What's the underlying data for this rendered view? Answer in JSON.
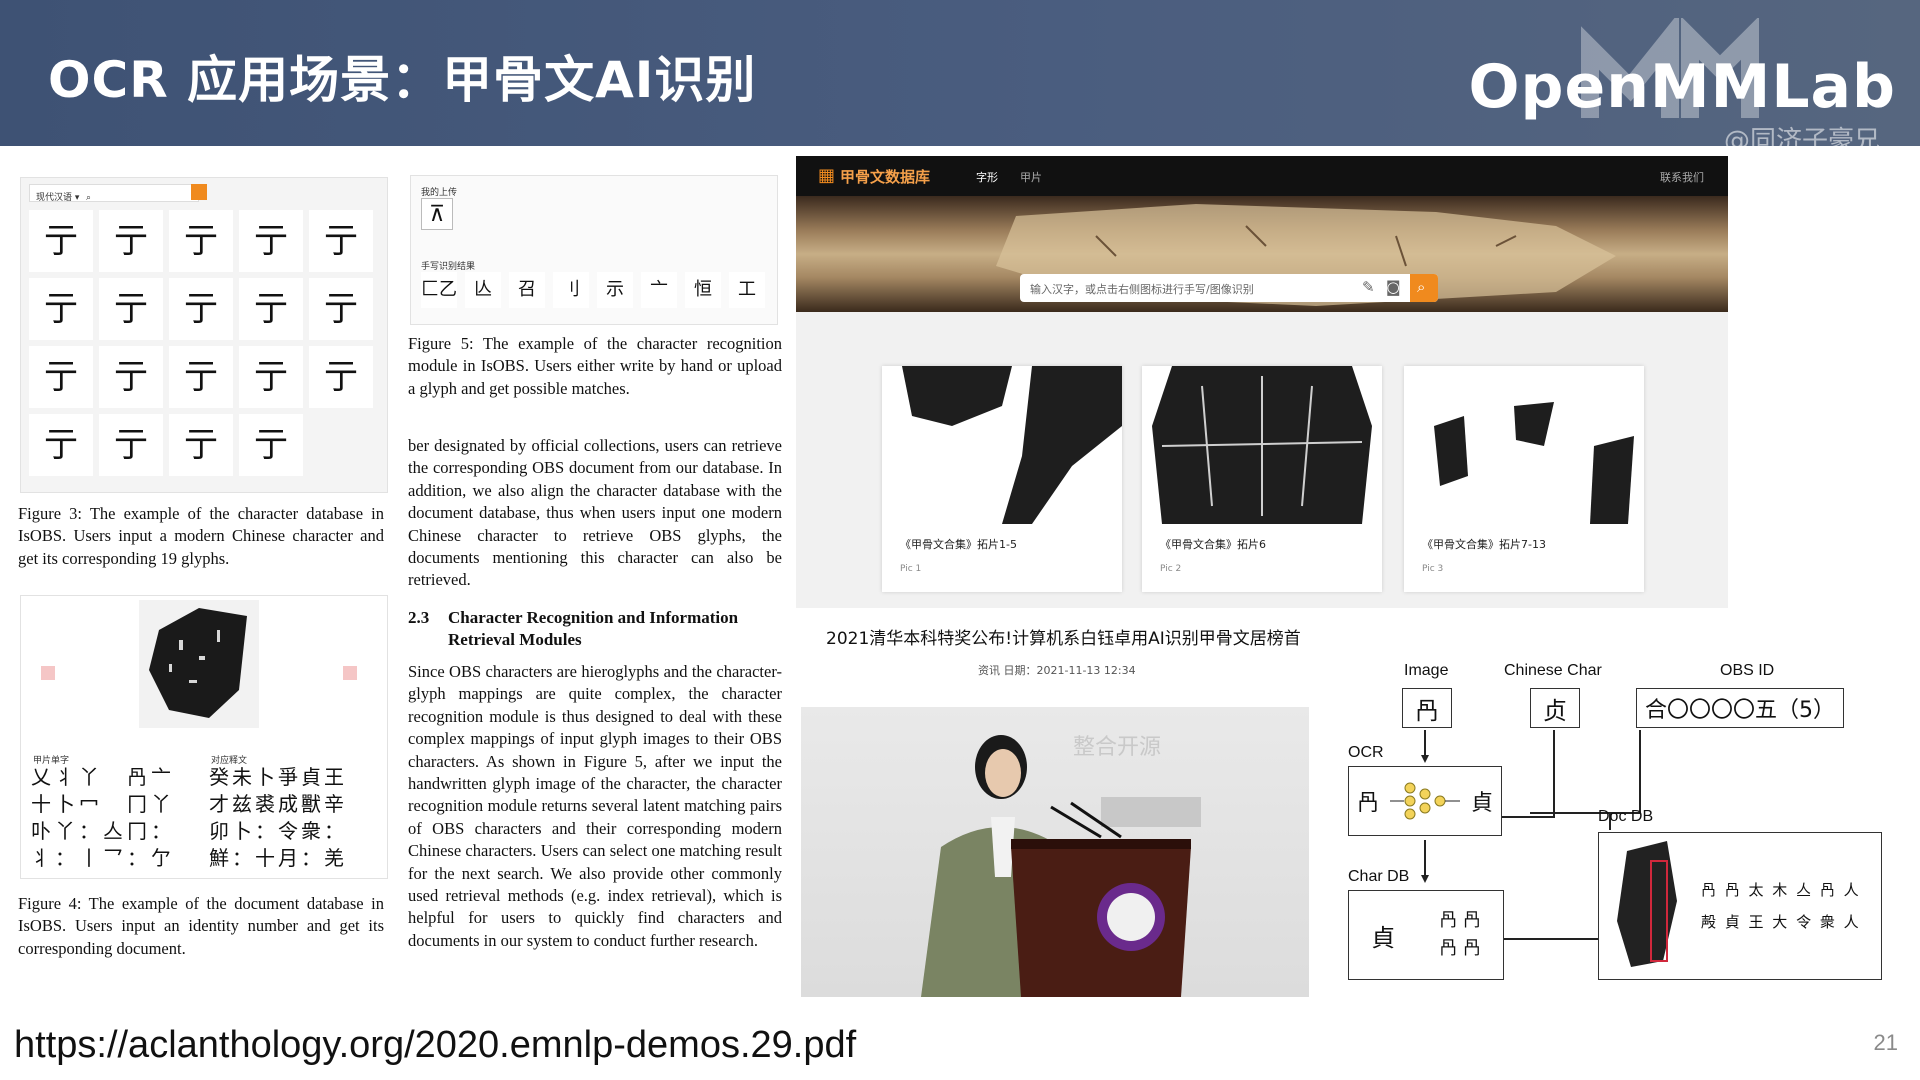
{
  "header": {
    "title": "OCR 应用场景：甲骨文AI识别",
    "logo": "OpenMMLab",
    "watermark": "@同济子豪兄"
  },
  "paper": {
    "fig3_caption": "Figure 3: The example of the character database in IsOBS. Users input a modern Chinese character and get its corresponding 19 glyphs.",
    "fig3_search_prefix": "现代汉语 ▾",
    "fig3_glyphs": [
      "亍",
      "亍",
      "亍",
      "亍",
      "亍",
      "亍",
      "亍",
      "亍",
      "亍",
      "亍",
      "亍",
      "亍",
      "亍",
      "亍",
      "亍",
      "亍",
      "亍",
      "亍",
      "亍"
    ],
    "fig4_caption": "Figure 4: The example of the document database in IsOBS. Users input an identity number and get its corresponding document.",
    "fig4_left_label": "甲片单字",
    "fig4_right_label": "对应释文",
    "fig4_right_rows": [
      "癸未卜爭貞王",
      "才兹裘成獸辛",
      "卯卜：令衆：",
      "鮮：十月：羌"
    ],
    "fig5_upload_label": "我的上传",
    "fig5_result_label": "手写识别结果",
    "fig5_results": [
      "匚乙",
      "亾",
      "召",
      "刂",
      "示",
      "亠",
      "恒",
      "工"
    ],
    "fig5_caption": "Figure 5: The example of the character recognition module in IsOBS. Users either write by hand or upload a glyph and get possible matches.",
    "body1": "ber designated by official collections, users can retrieve the corresponding OBS document from our database. In addition, we also align the character database with the document database, thus when users input one modern Chinese character to retrieve OBS glyphs, the documents mentioning this character can also be retrieved.",
    "section_number": "2.3",
    "section_title": "Character Recognition and Information Retrieval Modules",
    "body2": "Since OBS characters are hieroglyphs and the character-glyph mappings are quite complex, the character recognition module is thus designed to deal with these complex mappings of input glyph images to their OBS characters. As shown in Figure 5, after we input the handwritten glyph image of the character, the character recognition module returns several latent matching pairs of OBS characters and their corresponding modern Chinese characters. Users can select one matching result for the next search. We also provide other commonly used retrieval methods (e.g. index retrieval), which is helpful for users to quickly find characters and documents in our system to conduct further research."
  },
  "database": {
    "brand": "甲骨文数据库",
    "nav": [
      "字形",
      "甲片"
    ],
    "contact": "联系我们",
    "search_placeholder": "输入汉字，或点击右侧图标进行手写/图像识别",
    "cards": [
      {
        "title": "《甲骨文合集》拓片1-5",
        "sub": "Pic 1"
      },
      {
        "title": "《甲骨文合集》拓片6",
        "sub": "Pic 2"
      },
      {
        "title": "《甲骨文合集》拓片7-13",
        "sub": "Pic 3"
      }
    ]
  },
  "news": {
    "title": "2021清华本科特奖公布!计算机系白钰卓用AI识别甲骨文居榜首",
    "meta": "资讯  日期：2021-11-13 12:34",
    "backdrop_text": "整合开源"
  },
  "diagram": {
    "labels": {
      "image": "Image",
      "chinese_char": "Chinese Char",
      "obs_id": "OBS ID",
      "ocr": "OCR",
      "char_db": "Char DB",
      "doc_db": "Doc DB"
    },
    "image_glyph": "冎",
    "chinese_char_value": "贞",
    "obs_id_value": "合〇〇〇〇五（5）",
    "ocr_in": "冎",
    "ocr_out": "貞",
    "chardb_main": "貞",
    "doc_rows": [
      "冎 冎 太 木 亼 冎 人",
      "殸 貞 王 大 令 衆 人"
    ]
  },
  "footer": {
    "url": "https://aclanthology.org/2020.emnlp-demos.29.pdf",
    "page": "21"
  }
}
